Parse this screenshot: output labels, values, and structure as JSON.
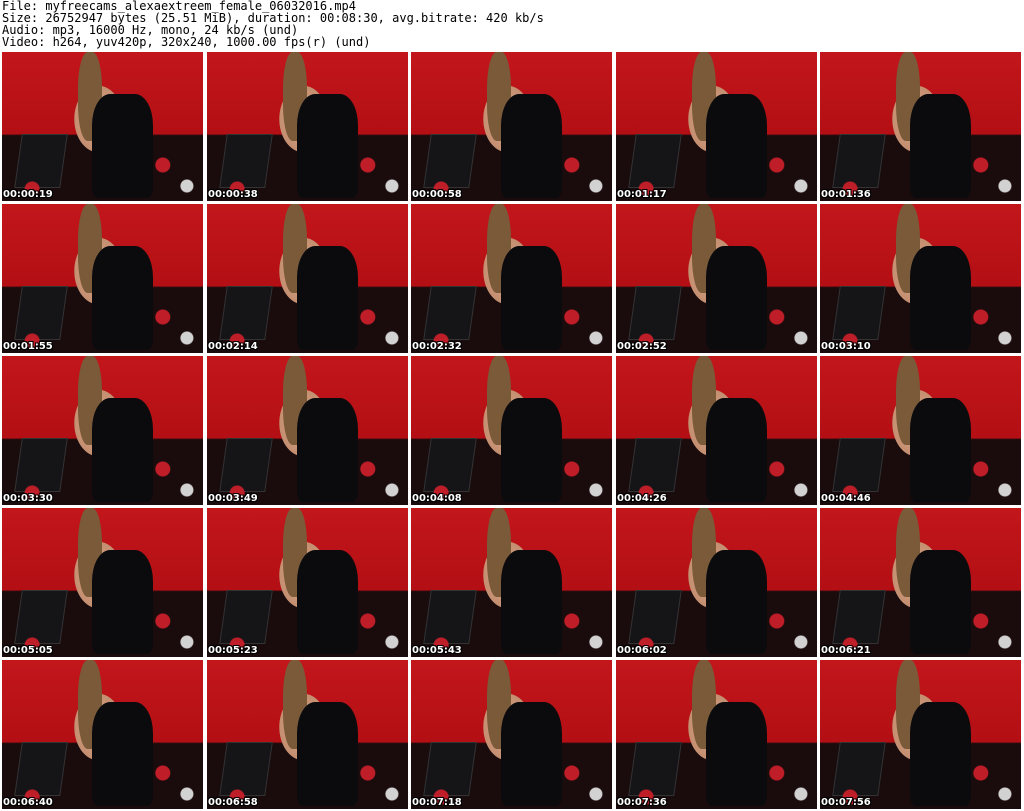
{
  "header": {
    "line1": "File: myfreecams_alexaextreem_female_06032016.mp4",
    "line2": "Size: 26752947 bytes (25.51 MiB), duration: 00:08:30, avg.bitrate: 420 kb/s",
    "line3": "Audio: mp3, 16000 Hz, mono, 24 kb/s (und)",
    "line4": "Video: h264, yuv420p, 320x240, 1000.00 fps(r) (und)"
  },
  "timestamps": [
    "00:00:19",
    "00:00:38",
    "00:00:58",
    "00:01:17",
    "00:01:36",
    "00:01:55",
    "00:02:14",
    "00:02:32",
    "00:02:52",
    "00:03:10",
    "00:03:30",
    "00:03:49",
    "00:04:08",
    "00:04:26",
    "00:04:46",
    "00:05:05",
    "00:05:23",
    "00:05:43",
    "00:06:02",
    "00:06:21",
    "00:06:40",
    "00:06:58",
    "00:07:18",
    "00:07:36",
    "00:07:56"
  ]
}
